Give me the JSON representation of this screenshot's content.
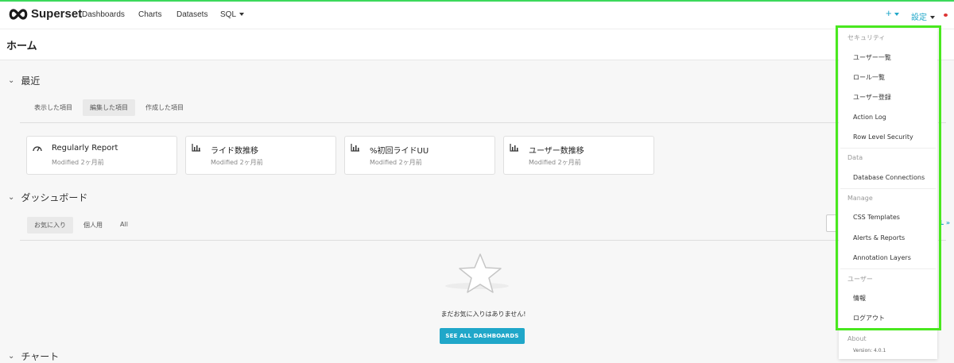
{
  "navbar": {
    "brand": "Superset",
    "items": [
      "Dashboards",
      "Charts",
      "Datasets",
      "SQL"
    ],
    "plus_label": "+",
    "settings_label": "設定"
  },
  "page": {
    "title": "ホーム"
  },
  "recent": {
    "title": "最近",
    "tabs": [
      "表示した項目",
      "編集した項目",
      "作成した項目"
    ],
    "active_tab": "編集した項目",
    "cards": [
      {
        "icon": "dashboard-gauge-icon",
        "title": "Regularly Report",
        "subtitle": "Modified 2ヶ月前"
      },
      {
        "icon": "bar-chart-icon",
        "title": "ライド数推移",
        "subtitle": "Modified 2ヶ月前"
      },
      {
        "icon": "bar-chart-icon",
        "title": "%初回ライドUU",
        "subtitle": "Modified 2ヶ月前"
      },
      {
        "icon": "bar-chart-icon",
        "title": "ユーザー数推移",
        "subtitle": "Modified 2ヶ月前"
      }
    ]
  },
  "dashboards": {
    "title": "ダッシュボード",
    "tabs": [
      "お気に入り",
      "個人用",
      "All"
    ],
    "active_tab": "お気に入り",
    "empty_message": "まだお気に入りはありません!",
    "see_all_label": "SEE ALL DASHBOARDS",
    "side_link": "L »"
  },
  "charts": {
    "title": "チャート"
  },
  "settings_menu": {
    "groups": [
      {
        "label": "セキュリティ",
        "items": [
          "ユーザー一覧",
          "ロール一覧",
          "ユーザー登録",
          "Action Log",
          "Row Level Security"
        ]
      },
      {
        "label": "Data",
        "items": [
          "Database Connections"
        ]
      },
      {
        "label": "Manage",
        "items": [
          "CSS Templates",
          "Alerts & Reports",
          "Annotation Layers"
        ]
      },
      {
        "label": "ユーザー",
        "items": [
          "情報",
          "ログアウト"
        ]
      },
      {
        "label": "About",
        "items": []
      }
    ],
    "version": "Version: 4.0.1"
  },
  "colors": {
    "accent": "#20a7c9",
    "highlight": "#49e81f"
  }
}
